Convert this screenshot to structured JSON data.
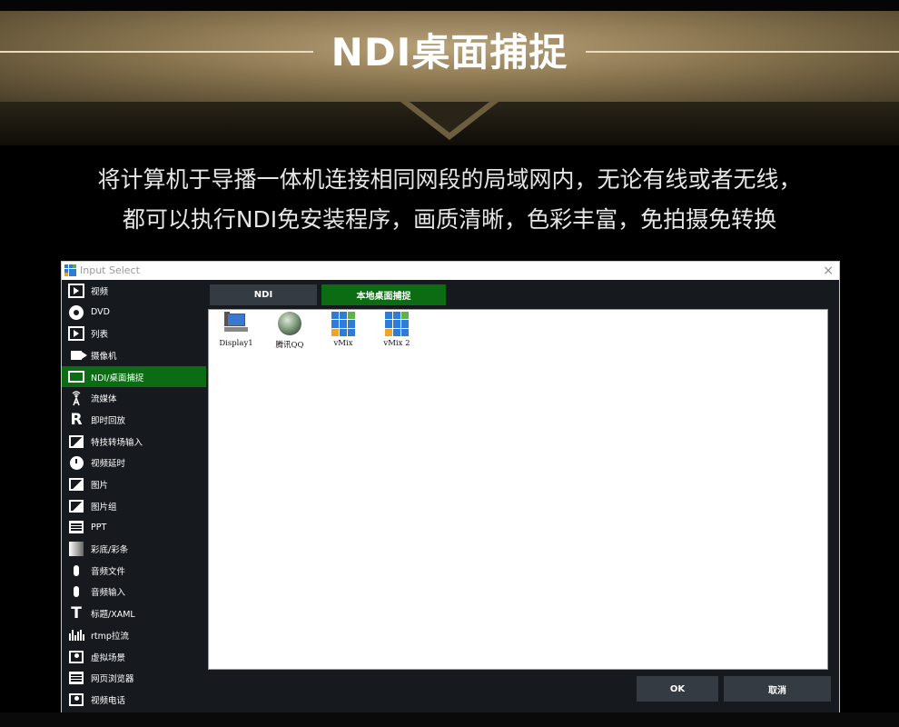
{
  "banner": {
    "title": "NDI桌面捕捉"
  },
  "description": {
    "line1": "将计算机于导播一体机连接相同网段的局域网内，无论有线或者无线，",
    "line2": "都可以执行NDI免安装程序，画质清晰，色彩丰富，免拍摄免转换"
  },
  "window": {
    "title": "Input Select",
    "close": "×"
  },
  "sidebar": {
    "items": [
      {
        "label": "视频",
        "icon": "video-icon",
        "active": false
      },
      {
        "label": "DVD",
        "icon": "dvd-icon",
        "active": false
      },
      {
        "label": "列表",
        "icon": "playlist-icon",
        "active": false
      },
      {
        "label": "摄像机",
        "icon": "camera-icon",
        "active": false
      },
      {
        "label": "NDI/桌面捕捉",
        "icon": "monitor-icon",
        "active": true
      },
      {
        "label": "流媒体",
        "icon": "stream-icon",
        "active": false
      },
      {
        "label": "即时回放",
        "icon": "replay-icon",
        "active": false
      },
      {
        "label": "特技转场输入",
        "icon": "stinger-icon",
        "active": false
      },
      {
        "label": "视频延时",
        "icon": "timer-icon",
        "active": false
      },
      {
        "label": "图片",
        "icon": "image-icon",
        "active": false
      },
      {
        "label": "图片组",
        "icon": "image-group-icon",
        "active": false
      },
      {
        "label": "PPT",
        "icon": "ppt-icon",
        "active": false
      },
      {
        "label": "彩底/彩条",
        "icon": "colour-bars-icon",
        "active": false
      },
      {
        "label": "音频文件",
        "icon": "audio-file-icon",
        "active": false
      },
      {
        "label": "音频输入",
        "icon": "audio-input-icon",
        "active": false
      },
      {
        "label": "标题/XAML",
        "icon": "title-icon",
        "active": false
      },
      {
        "label": "rtmp拉流",
        "icon": "rtmp-icon",
        "active": false
      },
      {
        "label": "虚拟场景",
        "icon": "virtual-set-icon",
        "active": false
      },
      {
        "label": "网页浏览器",
        "icon": "browser-icon",
        "active": false
      },
      {
        "label": "视频电话",
        "icon": "video-call-icon",
        "active": false
      }
    ]
  },
  "tabs": {
    "ndi": "NDI",
    "local": "本地桌面捕捉",
    "active": "local"
  },
  "sources": [
    {
      "label": "Display1",
      "icon": "computer-icon"
    },
    {
      "label": "腾讯QQ",
      "icon": "qq-avatar-icon"
    },
    {
      "label": "vMix",
      "icon": "vmix-icon"
    },
    {
      "label": "vMix 2",
      "icon": "vmix-icon"
    }
  ],
  "buttons": {
    "ok": "OK",
    "cancel": "取消"
  },
  "colors": {
    "accent_green": "#0b6c13",
    "panel_dark": "#161a1f",
    "button_gray": "#353b43",
    "banner_gold": "#a08b62"
  }
}
